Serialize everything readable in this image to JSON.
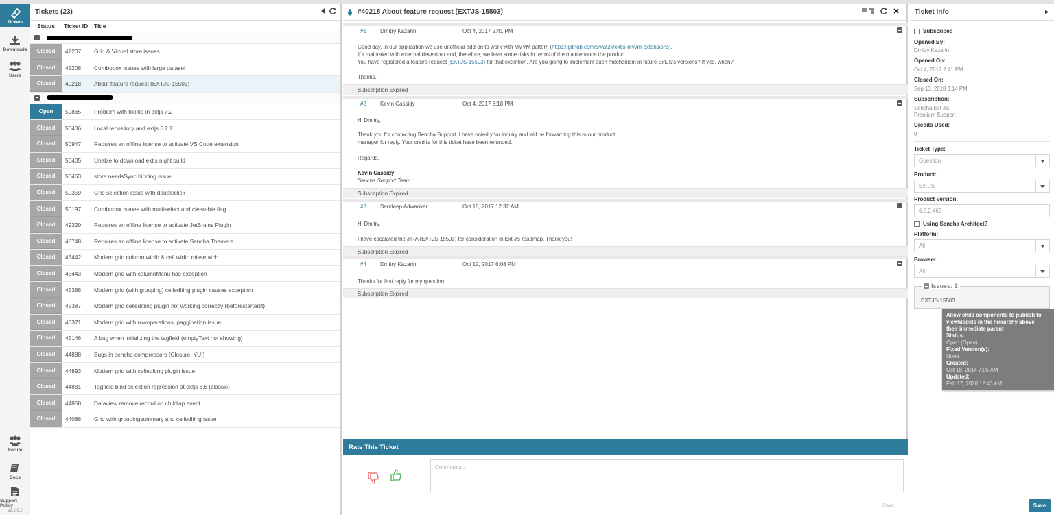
{
  "nav": {
    "items": [
      {
        "label": "Tickets"
      },
      {
        "label": "Downloads"
      },
      {
        "label": "Users"
      },
      {
        "label": "Forum"
      },
      {
        "label": "Docs"
      },
      {
        "label": "Support Policy"
      }
    ],
    "version": "v2.6.0.2"
  },
  "tickets": {
    "title": "Tickets (23)",
    "columns": {
      "status": "Status",
      "id": "Ticket ID",
      "title": "Title"
    },
    "group1": [
      {
        "status": "Closed",
        "id": "42207",
        "title": "Grid & Virtual store issues"
      },
      {
        "status": "Closed",
        "id": "42208",
        "title": "Combobox issues with large dataset"
      },
      {
        "status": "Closed",
        "id": "40218",
        "title": "About feature request (EXTJS-15503)"
      }
    ],
    "group2": [
      {
        "status": "Open",
        "id": "50865",
        "title": "Problem with tooltip in extjs 7.2"
      },
      {
        "status": "Closed",
        "id": "50406",
        "title": "Local repository and extjs 6.2.2"
      },
      {
        "status": "Closed",
        "id": "50947",
        "title": "Requires an offline license to activate VS Code extension"
      },
      {
        "status": "Closed",
        "id": "50405",
        "title": "Unable to download extjs night build"
      },
      {
        "status": "Closed",
        "id": "50453",
        "title": "store.needsSync binding issue"
      },
      {
        "status": "Closed",
        "id": "50359",
        "title": "Grid selection issue with doubleclick"
      },
      {
        "status": "Closed",
        "id": "50197",
        "title": "Combobox issues with multiselect and clearable flag"
      },
      {
        "status": "Closed",
        "id": "49320",
        "title": "Requires an offline license to activate JetBrains Plugin"
      },
      {
        "status": "Closed",
        "id": "48748",
        "title": "Requires an offline license to activate Sencha Themere"
      },
      {
        "status": "Closed",
        "id": "45442",
        "title": "Modern grid column width & cell width missmatch"
      },
      {
        "status": "Closed",
        "id": "45443",
        "title": "Modern grid with columnMenu has exception"
      },
      {
        "status": "Closed",
        "id": "45388",
        "title": "Modern grid (with grouping) cellediting plugin causes exception"
      },
      {
        "status": "Closed",
        "id": "45387",
        "title": "Modern grid celleditiing plugin not working correctly (beforestartedit)"
      },
      {
        "status": "Closed",
        "id": "45371",
        "title": "Modern grid with rowoperations, paggination issue"
      },
      {
        "status": "Closed",
        "id": "45146",
        "title": "A bug when initializing the tagfield (emptyText not showing)"
      },
      {
        "status": "Closed",
        "id": "44888",
        "title": "Bugs in sencha compressors (Closure, YUI)"
      },
      {
        "status": "Closed",
        "id": "44893",
        "title": "Modern grid with celledIting plugin issue"
      },
      {
        "status": "Closed",
        "id": "44881",
        "title": "Tagfield bind selection regression at extjs 6.6 (classic)"
      },
      {
        "status": "Closed",
        "id": "44858",
        "title": "Dataview remove record on childtap event"
      },
      {
        "status": "Closed",
        "id": "44088",
        "title": "Grid with groupingsummary and cellediting issue"
      }
    ]
  },
  "conversation": {
    "title": "#40218 About feature request (EXTJS-15503)",
    "messages": [
      {
        "num": "#1",
        "author": "Dmitry Kazarin",
        "date": "Oct 4, 2017 2:41 PM",
        "l1_pre": "Good day. In our application we use unofficial add-on to work with MVVM pattern (",
        "l1_link": "https://github.com/Swat2k/extjs-mvvm-extensions",
        "l1_post": ").",
        "l2": "It's maintaied with external developer and, therefore, we bear some risks in terms of the maintenance the product.",
        "l3_pre": "You have registered a feature request (",
        "l3_link": "EXTJS-15503",
        "l3_post": ") for that extention. Are you going to implement such mechanism in future ExtJS's versions? If yes, when?",
        "l4": "Thanks.",
        "sub": "Subscription Expired"
      },
      {
        "num": "#2",
        "author": "Kevin Cassidy",
        "date": "Oct 4, 2017 6:18 PM",
        "l1": "Hi Dmitry,",
        "l2": "Thank you for contacting Sencha Support. I have noted your inquiry and will be forwarding this to our product",
        "l3": "manager for reply. Your credits for this ticket have been refunded.",
        "l4": "Regards,",
        "sig_name": "Kevin Cassidy",
        "sig_team": "Sencha Support Team",
        "sub": "Subscription Expired"
      },
      {
        "num": "#3",
        "author": "Sandeep Adwankar",
        "date": "Oct 10, 2017 12:32 AM",
        "l1": "Hi Dmitry,",
        "l2": "I have escalated the JIRA (EXTJS-15503) for consideration in Ext JS roadmap. Thank you!",
        "sub": "Subscription Expired"
      },
      {
        "num": "#4",
        "author": "Dmitry Kazarin",
        "date": "Oct 12, 2017 6:08 PM",
        "l1": "Thanks for fast reply for my question",
        "sub": "Subscription Expired"
      }
    ],
    "rate_title": "Rate This Ticket",
    "comments_placeholder": "Comments...",
    "save_label": "Save"
  },
  "info": {
    "title": "Ticket Info",
    "subscribed_label": "Subscribed",
    "opened_by_label": "Opened By:",
    "opened_by": "Dmitry Kazarin",
    "opened_on_label": "Opened On:",
    "opened_on": "Oct 4, 2017 2:41 PM",
    "closed_on_label": "Closed On:",
    "closed_on": "Sep 13, 2018 3:14 PM",
    "subscription_label": "Subscription:",
    "subscription_1": "Sencha Ext JS",
    "subscription_2": "Premium Support",
    "credits_label": "Credits Used:",
    "credits": "0",
    "ticket_type_label": "Ticket Type:",
    "ticket_type": "Question",
    "product_label": "Product:",
    "product": "Ext JS",
    "product_version_label": "Product Version:",
    "product_version": "6.5.2.463",
    "architect_label": "Using Sencha Architect?",
    "platform_label": "Platform:",
    "platform": "All",
    "browser_label": "Browser:",
    "browser": "All",
    "issues_label": "Issues: 1",
    "issue": "EXTJS-15503",
    "save_label": "Save"
  },
  "tooltip": {
    "title_1": "Allow child components to publish to",
    "title_2": "viewModels in the hierarchy above",
    "title_3": "their immediate parent",
    "status_label": "Status:",
    "status": "Open (Open)",
    "fixed_label": "Fixed Version(s):",
    "fixed": "None",
    "created_label": "Created:",
    "created": "Oct 18, 2014 7:05 AM",
    "updated_label": "Updated:",
    "updated": "Feb 17, 2020 12:43 AM"
  }
}
